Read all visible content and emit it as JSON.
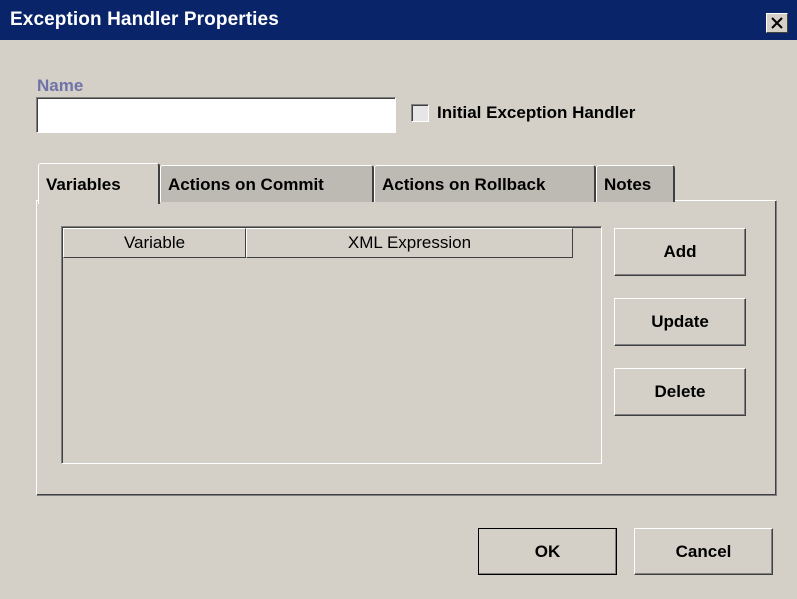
{
  "window": {
    "title": "Exception Handler Properties",
    "close_icon": "close-icon"
  },
  "form": {
    "name_label": "Name",
    "name_value": "",
    "name_placeholder": "",
    "initial_handler_label": "Initial Exception Handler",
    "initial_handler_checked": false
  },
  "tabs": [
    {
      "label": "Variables",
      "selected": true
    },
    {
      "label": "Actions on Commit",
      "selected": false
    },
    {
      "label": "Actions on Rollback",
      "selected": false
    },
    {
      "label": "Notes",
      "selected": false
    }
  ],
  "variables_table": {
    "columns": [
      "Variable",
      "XML Expression"
    ],
    "rows": []
  },
  "side_buttons": {
    "add": "Add",
    "update": "Update",
    "delete": "Delete"
  },
  "footer": {
    "ok": "OK",
    "cancel": "Cancel"
  },
  "colors": {
    "titlebar": "#0a246a",
    "dialog_bg": "#d4d0c8",
    "name_label": "#6f73a8"
  }
}
